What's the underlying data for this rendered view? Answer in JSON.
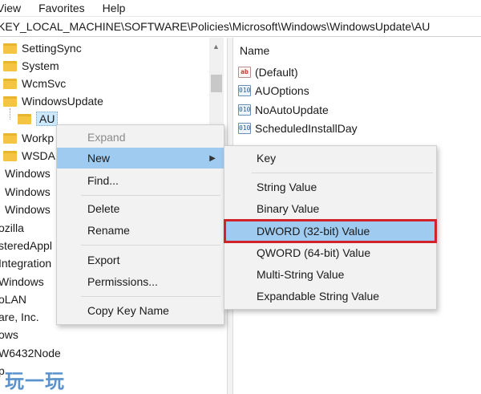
{
  "menubar": {
    "items": [
      "View",
      "Favorites",
      "Help"
    ]
  },
  "address": {
    "path": "KEY_LOCAL_MACHINE\\SOFTWARE\\Policies\\Microsoft\\Windows\\WindowsUpdate\\AU"
  },
  "tree": {
    "items": [
      {
        "label": "SettingSync"
      },
      {
        "label": "System"
      },
      {
        "label": "WcmSvc"
      },
      {
        "label": "WindowsUpdate"
      },
      {
        "label": "AU"
      },
      {
        "label": "Workp"
      },
      {
        "label": "WSDA"
      },
      {
        "label": "Windows"
      },
      {
        "label": "Windows"
      },
      {
        "label": "Windows"
      },
      {
        "label": "ozilla"
      },
      {
        "label": "steredAppl"
      },
      {
        "label": "Integration"
      },
      {
        "label": "Windows"
      },
      {
        "label": "oLAN"
      },
      {
        "label": "are, Inc."
      },
      {
        "label": "ows"
      },
      {
        "label": "W6432Node"
      },
      {
        "label": "p"
      }
    ]
  },
  "values_pane": {
    "header": "Name",
    "items": [
      {
        "label": "(Default)",
        "icon": "ab"
      },
      {
        "label": "AUOptions",
        "icon": "010"
      },
      {
        "label": "NoAutoUpdate",
        "icon": "010"
      },
      {
        "label": "ScheduledInstallDay",
        "icon": "010"
      }
    ]
  },
  "context_menu": {
    "items": [
      {
        "label": "Expand"
      },
      {
        "label": "New"
      },
      {
        "label": "Find..."
      },
      {
        "label": "Delete"
      },
      {
        "label": "Rename"
      },
      {
        "label": "Export"
      },
      {
        "label": "Permissions..."
      },
      {
        "label": "Copy Key Name"
      }
    ]
  },
  "submenu": {
    "items": [
      {
        "label": "Key"
      },
      {
        "label": "String Value"
      },
      {
        "label": "Binary Value"
      },
      {
        "label": "DWORD (32-bit) Value"
      },
      {
        "label": "QWORD (64-bit) Value"
      },
      {
        "label": "Multi-String Value"
      },
      {
        "label": "Expandable String Value"
      }
    ]
  },
  "watermark": {
    "text": "玩一玩"
  },
  "colors": {
    "hover": "#9fcbf0",
    "highlight_border": "#d2232a",
    "folder": "#f4c542"
  }
}
